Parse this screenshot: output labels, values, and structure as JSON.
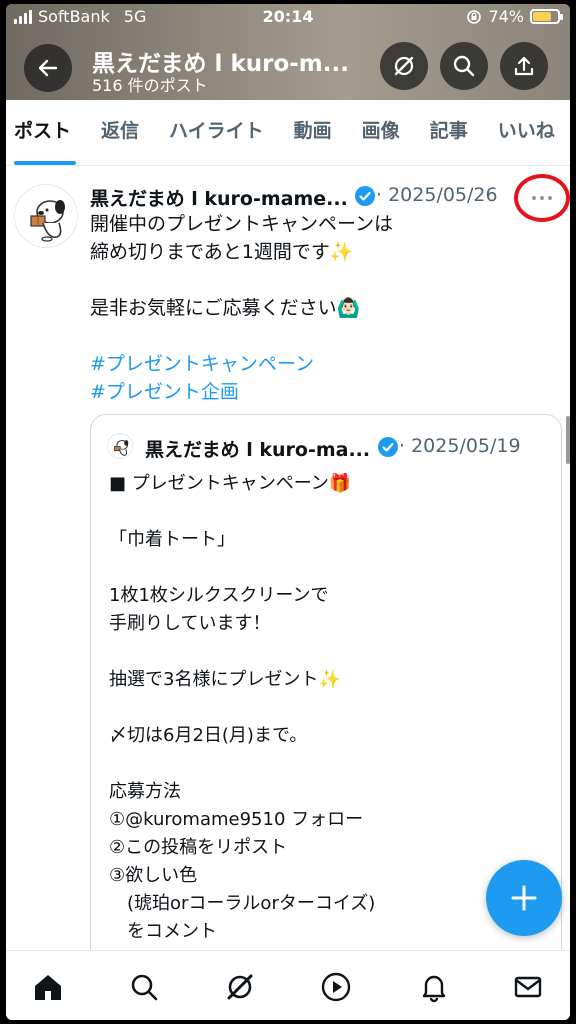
{
  "status_bar": {
    "carrier": "SoftBank",
    "network": "5G",
    "time": "20:14",
    "battery": "74%"
  },
  "profile": {
    "name": "黒えだまめ l kuro-m...",
    "post_count": "516 件のポスト"
  },
  "tabs": [
    {
      "label": "ポスト",
      "active": true
    },
    {
      "label": "返信"
    },
    {
      "label": "ハイライト"
    },
    {
      "label": "動画"
    },
    {
      "label": "画像"
    },
    {
      "label": "記事"
    },
    {
      "label": "いいね"
    }
  ],
  "post": {
    "author": "黒えだまめ l kuro-mame...",
    "date": "2025/05/26",
    "lines": [
      "開催中のプレゼントキャンペーンは",
      "締め切りまであと1週間です✨",
      "",
      "是非お気軽にご応募ください🙆🏻‍♂️",
      ""
    ],
    "hashtags": [
      "#プレゼントキャンペーン",
      "#プレゼント企画"
    ]
  },
  "quote": {
    "author": "黒えだまめ l kuro-ma...",
    "date": "2025/05/19",
    "lines": [
      "■ プレゼントキャンペーン🎁",
      "",
      "「巾着トート」",
      "",
      "1枚1枚シルクスクリーンで",
      "手刷りしています！",
      "",
      "抽選で3名様にプレゼント✨",
      "",
      "〆切は6月2日(月)まで。",
      "",
      "応募方法",
      "①@kuromame9510 フォロー",
      "②この投稿をリポスト",
      "③欲しい色",
      "　(琥珀orコーラルorターコイズ)",
      "　をコメント"
    ]
  },
  "colors": {
    "accent": "#1d9bf0",
    "highlight_circle": "#e5141b"
  },
  "bottom_nav": [
    "home-icon",
    "search-icon",
    "grok-icon",
    "video-icon",
    "notifications-icon",
    "messages-icon"
  ]
}
